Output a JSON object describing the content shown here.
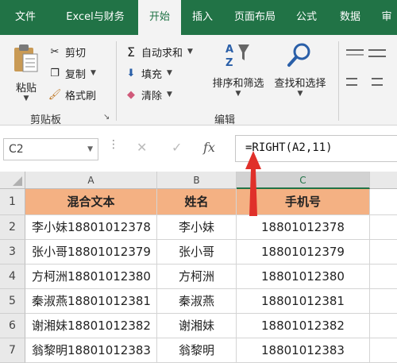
{
  "ribbon": {
    "tabs": [
      "文件",
      "Excel与财务",
      "开始",
      "插入",
      "页面布局",
      "公式",
      "数据",
      "审"
    ],
    "active_tab": "开始",
    "clipboard": {
      "paste": "粘贴",
      "cut": "剪切",
      "copy": "复制",
      "format_painter": "格式刷",
      "group": "剪贴板"
    },
    "editing": {
      "autosum": "自动求和",
      "fill": "填充",
      "clear": "清除",
      "sort_filter": "排序和筛选",
      "find_select": "查找和选择",
      "group": "编辑"
    }
  },
  "formula_bar": {
    "name_box": "C2",
    "fx": "fx",
    "formula": "=RIGHT(A2,11)"
  },
  "grid": {
    "columns": [
      "A",
      "B",
      "C"
    ],
    "headers": [
      "混合文本",
      "姓名",
      "手机号"
    ],
    "rows": [
      {
        "num": "1"
      },
      {
        "num": "2",
        "a": "李小妹18801012378",
        "b": "李小妹",
        "c": "18801012378"
      },
      {
        "num": "3",
        "a": "张小哥18801012379",
        "b": "张小哥",
        "c": "18801012379"
      },
      {
        "num": "4",
        "a": "方柯洲18801012380",
        "b": "方柯洲",
        "c": "18801012380"
      },
      {
        "num": "5",
        "a": "秦淑燕18801012381",
        "b": "秦淑燕",
        "c": "18801012381"
      },
      {
        "num": "6",
        "a": "谢湘妹18801012382",
        "b": "谢湘妹",
        "c": "18801012382"
      },
      {
        "num": "7",
        "a": "翁黎明18801012383",
        "b": "翁黎明",
        "c": "18801012383"
      }
    ]
  },
  "colors": {
    "excel_green": "#217346",
    "header_fill": "#f4b183",
    "arrow": "#e0302a"
  }
}
